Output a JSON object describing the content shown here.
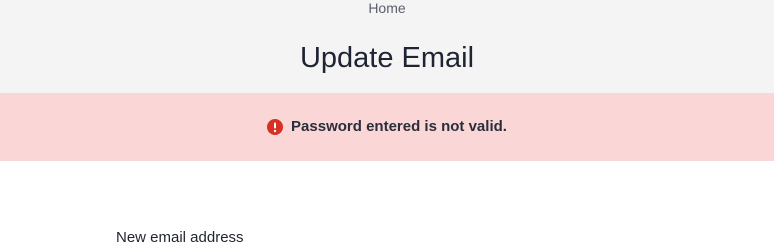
{
  "header": {
    "breadcrumb": "Home",
    "title": "Update Email"
  },
  "alert": {
    "icon": "error-icon",
    "message": "Password entered is not valid.",
    "color": "#d93025",
    "background": "#fad6d6"
  },
  "form": {
    "new_email_label": "New email address"
  }
}
